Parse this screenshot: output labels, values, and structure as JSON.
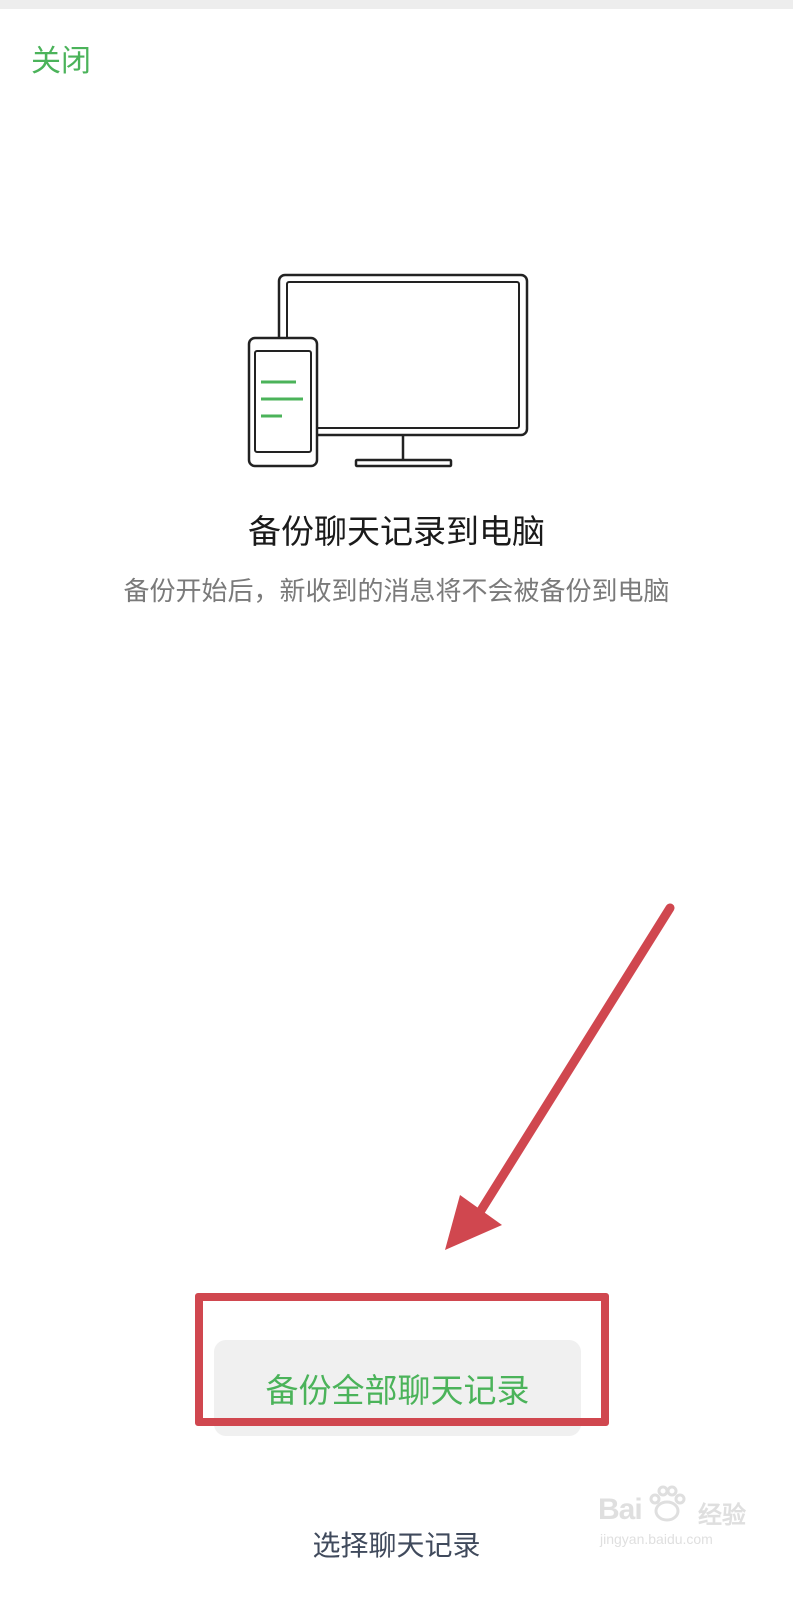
{
  "header": {
    "close_label": "关闭"
  },
  "illustration": {
    "icon": "phone-to-computer-icon",
    "accent_color": "#4bb35a"
  },
  "content": {
    "title": "备份聊天记录到电脑",
    "subtitle": "备份开始后，新收到的消息将不会被备份到电脑"
  },
  "actions": {
    "backup_all_label": "备份全部聊天记录",
    "select_label": "选择聊天记录"
  },
  "annotation": {
    "arrow_color": "#d0474f",
    "box_color": "#d0474f"
  },
  "watermark": {
    "brand": "Bai",
    "brand_cn": "经验",
    "url": "jingyan.baidu.com"
  }
}
